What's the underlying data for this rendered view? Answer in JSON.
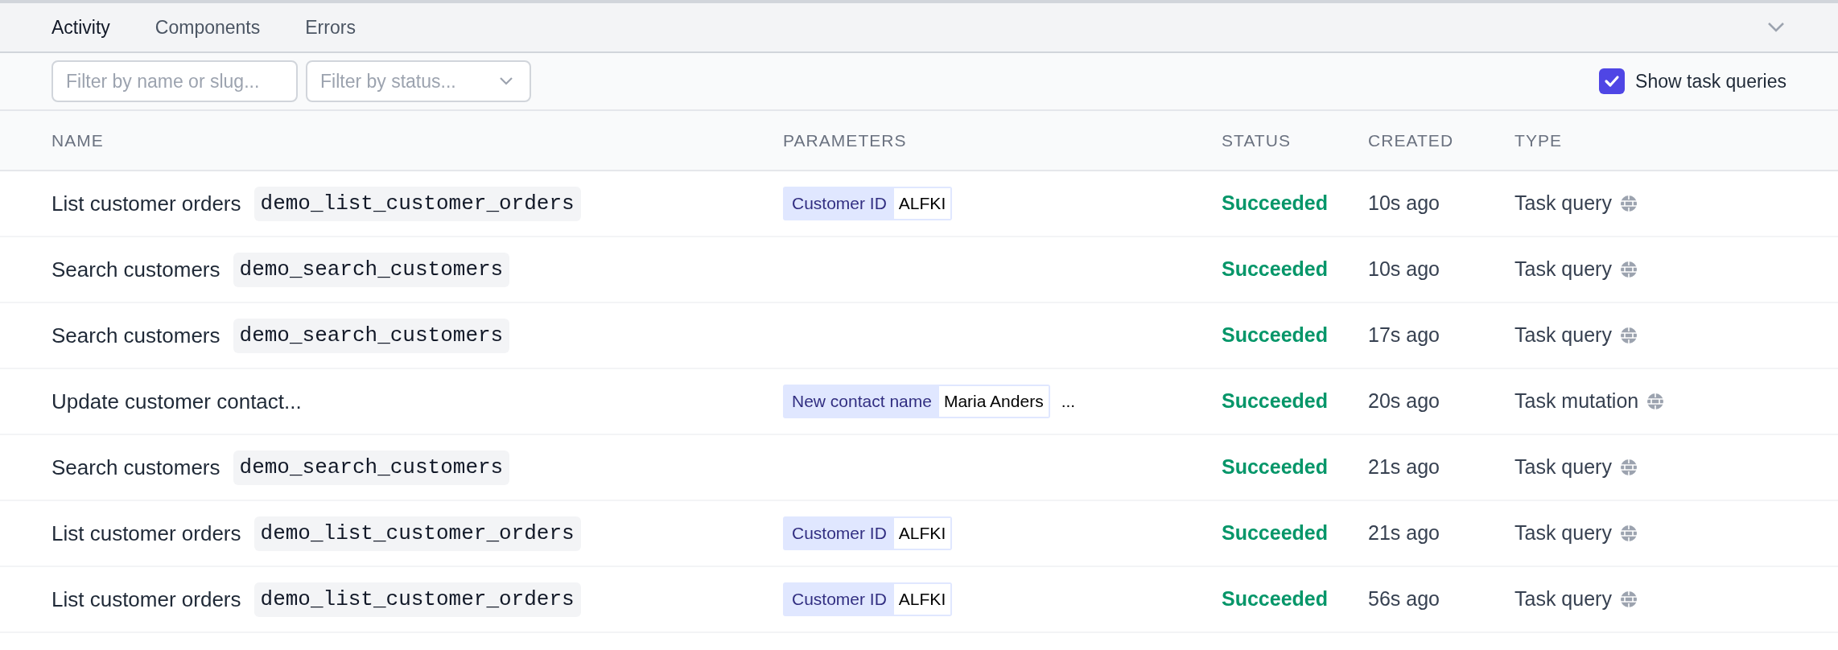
{
  "tabs": [
    {
      "label": "Activity",
      "selected": true
    },
    {
      "label": "Components",
      "selected": false
    },
    {
      "label": "Errors",
      "selected": false
    }
  ],
  "filters": {
    "name_search": {
      "placeholder": "Filter by name or slug..."
    },
    "status_select": {
      "placeholder": "Filter by status..."
    },
    "show_task_queries": {
      "label": "Show task queries",
      "checked": true
    }
  },
  "table": {
    "columns": [
      "NAME",
      "PARAMETERS",
      "STATUS",
      "CREATED",
      "TYPE"
    ],
    "rows": [
      {
        "name": "List customer orders",
        "slug": "demo_list_customer_orders",
        "parameters": [
          {
            "label": "Customer ID",
            "value": "ALFKI"
          }
        ],
        "more": "",
        "status": "Succeeded",
        "created": "10s ago",
        "type": "Task query"
      },
      {
        "name": "Search customers",
        "slug": "demo_search_customers",
        "parameters": [],
        "more": "",
        "status": "Succeeded",
        "created": "10s ago",
        "type": "Task query"
      },
      {
        "name": "Search customers",
        "slug": "demo_search_customers",
        "parameters": [],
        "more": "",
        "status": "Succeeded",
        "created": "17s ago",
        "type": "Task query"
      },
      {
        "name": "Update customer contact...",
        "slug": "",
        "parameters": [
          {
            "label": "New contact name",
            "value": "Maria Anders"
          }
        ],
        "more": "...",
        "status": "Succeeded",
        "created": "20s ago",
        "type": "Task mutation"
      },
      {
        "name": "Search customers",
        "slug": "demo_search_customers",
        "parameters": [],
        "more": "",
        "status": "Succeeded",
        "created": "21s ago",
        "type": "Task query"
      },
      {
        "name": "List customer orders",
        "slug": "demo_list_customer_orders",
        "parameters": [
          {
            "label": "Customer ID",
            "value": "ALFKI"
          }
        ],
        "more": "",
        "status": "Succeeded",
        "created": "21s ago",
        "type": "Task query"
      },
      {
        "name": "List customer orders",
        "slug": "demo_list_customer_orders",
        "parameters": [
          {
            "label": "Customer ID",
            "value": "ALFKI"
          }
        ],
        "more": "",
        "status": "Succeeded",
        "created": "56s ago",
        "type": "Task query"
      }
    ]
  }
}
